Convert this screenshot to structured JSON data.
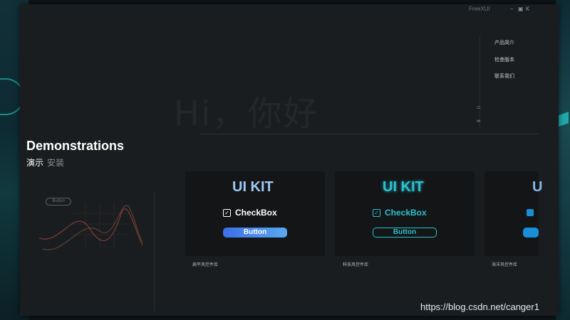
{
  "window": {
    "app_title": "FreeXUI",
    "controls": {
      "minimize": "–",
      "maximize": "▣",
      "close": "K"
    }
  },
  "side_menu": {
    "items": [
      {
        "label": "产品简介"
      },
      {
        "label": "检查版本"
      },
      {
        "label": "联系我们"
      }
    ],
    "icons": [
      "home-icon",
      "link-icon"
    ]
  },
  "hero": {
    "text": "Hi，你好"
  },
  "section": {
    "title": "Demonstrations",
    "tabs": [
      {
        "label": "演示",
        "active": true
      },
      {
        "label": "安装",
        "active": false
      }
    ]
  },
  "preview": {
    "button_label": "Button"
  },
  "cards": [
    {
      "kit": "UI KIT",
      "checkbox": "CheckBox",
      "button": "Button",
      "caption": "扁平风控件库",
      "accent": "#5aa8f0"
    },
    {
      "kit": "UI KIT",
      "checkbox": "CheckBox",
      "button": "Button",
      "caption": "科技风控件库",
      "accent": "#2ec0cf"
    },
    {
      "kit": "U",
      "checkbox": "",
      "button": "",
      "caption": "海洋风控件库",
      "accent": "#1a8fd8"
    }
  ],
  "watermark": "https://blog.csdn.net/canger1"
}
